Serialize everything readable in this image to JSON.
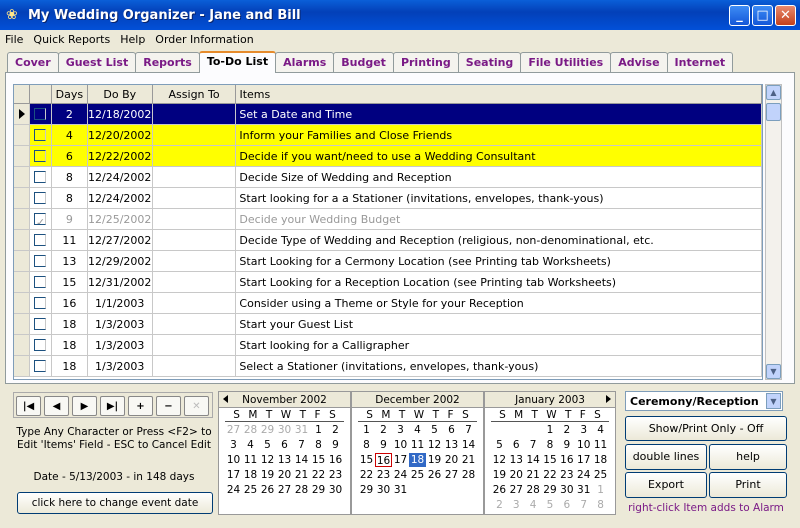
{
  "window": {
    "title": "My Wedding Organizer - Jane and Bill"
  },
  "menu": [
    "File",
    "Quick Reports",
    "Help",
    "Order Information"
  ],
  "tabs": [
    "Cover",
    "Guest List",
    "Reports",
    "To-Do List",
    "Alarms",
    "Budget",
    "Printing",
    "Seating",
    "File Utilities",
    "Advise",
    "Internet"
  ],
  "active_tab": "To-Do List",
  "grid": {
    "headers": [
      "Days",
      "Do By",
      "Assign To",
      "Items"
    ],
    "rows": [
      {
        "days": "2",
        "do_by": "12/18/2002",
        "assign": "",
        "item": "Set a Date and Time",
        "checked": false,
        "style": "sel"
      },
      {
        "days": "4",
        "do_by": "12/20/2002",
        "assign": "",
        "item": "Inform your Families and Close Friends",
        "checked": false,
        "style": "yellow"
      },
      {
        "days": "6",
        "do_by": "12/22/2002",
        "assign": "",
        "item": "Decide if you want/need to use a Wedding Consultant",
        "checked": false,
        "style": "yellow"
      },
      {
        "days": "8",
        "do_by": "12/24/2002",
        "assign": "",
        "item": "Decide Size of Wedding and Reception",
        "checked": false,
        "style": ""
      },
      {
        "days": "8",
        "do_by": "12/24/2002",
        "assign": "",
        "item": "Start looking for a a Stationer (invitations, envelopes, thank-yous)",
        "checked": false,
        "style": ""
      },
      {
        "days": "9",
        "do_by": "12/25/2002",
        "assign": "",
        "item": "Decide your Wedding Budget",
        "checked": true,
        "style": "done"
      },
      {
        "days": "11",
        "do_by": "12/27/2002",
        "assign": "",
        "item": "Decide Type of Wedding and Reception (religious, non-denominational, etc.",
        "checked": false,
        "style": ""
      },
      {
        "days": "13",
        "do_by": "12/29/2002",
        "assign": "",
        "item": "Start Looking for a Cermony Location (see Printing tab Worksheets)",
        "checked": false,
        "style": ""
      },
      {
        "days": "15",
        "do_by": "12/31/2002",
        "assign": "",
        "item": "Start Looking for a Reception Location (see Printing tab Worksheets)",
        "checked": false,
        "style": ""
      },
      {
        "days": "16",
        "do_by": "1/1/2003",
        "assign": "",
        "item": "Consider using a Theme or Style for your Reception",
        "checked": false,
        "style": ""
      },
      {
        "days": "18",
        "do_by": "1/3/2003",
        "assign": "",
        "item": "Start your Guest List",
        "checked": false,
        "style": ""
      },
      {
        "days": "18",
        "do_by": "1/3/2003",
        "assign": "",
        "item": "Start looking for a Calligrapher",
        "checked": false,
        "style": ""
      },
      {
        "days": "18",
        "do_by": "1/3/2003",
        "assign": "",
        "item": "Select a Stationer (invitations, envelopes, thank-yous)",
        "checked": false,
        "style": ""
      }
    ]
  },
  "nav": {
    "first": "|◀",
    "prev": "◀",
    "next": "▶",
    "last": "▶|",
    "add": "+",
    "remove": "−",
    "cancel": "✕"
  },
  "help_text": "Type Any Character or Press <F2> to Edit 'Items' Field - ESC to Cancel Edit",
  "date_text": "Date - 5/13/2003 - in 148 days",
  "event_button": "click here to change event date",
  "calendar": {
    "dow": [
      "S",
      "M",
      "T",
      "W",
      "T",
      "F",
      "S"
    ],
    "months": [
      {
        "name": "November 2002",
        "days": [
          "27",
          "28",
          "29",
          "30",
          "31",
          "1",
          "2",
          "3",
          "4",
          "5",
          "6",
          "7",
          "8",
          "9",
          "10",
          "11",
          "12",
          "13",
          "14",
          "15",
          "16",
          "17",
          "18",
          "19",
          "20",
          "21",
          "22",
          "23",
          "24",
          "25",
          "26",
          "27",
          "28",
          "29",
          "30"
        ],
        "grey_leading": 5,
        "grey_trailing": 0,
        "today": -1,
        "selected": -1
      },
      {
        "name": "December 2002",
        "days": [
          "1",
          "2",
          "3",
          "4",
          "5",
          "6",
          "7",
          "8",
          "9",
          "10",
          "11",
          "12",
          "13",
          "14",
          "15",
          "16",
          "17",
          "18",
          "19",
          "20",
          "21",
          "22",
          "23",
          "24",
          "25",
          "26",
          "27",
          "28",
          "29",
          "30",
          "31"
        ],
        "grey_leading": 0,
        "grey_trailing": 0,
        "today": 15,
        "selected": 17
      },
      {
        "name": "January 2003",
        "days": [
          "1",
          "2",
          "3",
          "4",
          "5",
          "6",
          "7",
          "8",
          "9",
          "10",
          "11",
          "12",
          "13",
          "14",
          "15",
          "16",
          "17",
          "18",
          "19",
          "20",
          "21",
          "22",
          "23",
          "24",
          "25",
          "26",
          "27",
          "28",
          "29",
          "30",
          "31",
          "1",
          "2",
          "3",
          "4",
          "5",
          "6",
          "7",
          "8"
        ],
        "grey_leading": 0,
        "grey_trailing": 8,
        "offset": 3,
        "today": -1,
        "selected": -1
      }
    ]
  },
  "dropdown": {
    "value": "Ceremony/Reception"
  },
  "buttons": {
    "show_print": "Show/Print Only - Off",
    "double_lines": "double lines",
    "help": "help",
    "export": "Export",
    "print": "Print"
  },
  "hint": "right-click Item adds to Alarm"
}
